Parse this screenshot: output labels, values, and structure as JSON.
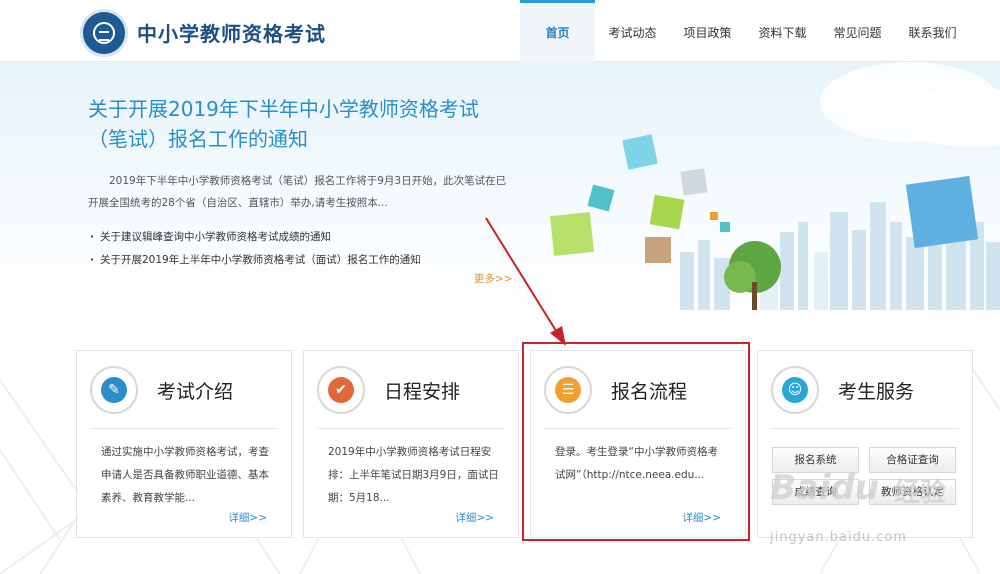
{
  "header": {
    "site_title": "中小学教师资格考试",
    "nav": [
      {
        "label": "首页",
        "active": true
      },
      {
        "label": "考试动态"
      },
      {
        "label": "项目政策"
      },
      {
        "label": "资料下载"
      },
      {
        "label": "常见问题"
      },
      {
        "label": "联系我们"
      }
    ]
  },
  "banner": {
    "headline": "关于开展2019年下半年中小学教师资格考试（笔试）报名工作的通知",
    "summary": "2019年下半年中小学教师资格考试（笔试）报名工作将于9月3日开始，此次笔试在已开展全国统考的28个省（自治区、直辖市）举办,请考生按照本...",
    "links": [
      "关于建议辑峰查询中小学教师资格考试成绩的通知",
      "关于开展2019年上半年中小学教师资格考试（面试）报名工作的通知"
    ],
    "more": "更多>>"
  },
  "cards": [
    {
      "title": "考试介绍",
      "icon": "document-edit-icon",
      "color": "#2a8fc8",
      "desc": "通过实施中小学教师资格考试，考查申请人是否具备教师职业道德、基本素养、教育教学能...",
      "detail": "详细>>"
    },
    {
      "title": "日程安排",
      "icon": "checkmark-icon",
      "color": "#e2683a",
      "desc": "2019年中小学教师资格考试日程安排：上半年笔试日期3月9日，面试日期：5月18...",
      "detail": "详细>>"
    },
    {
      "title": "报名流程",
      "icon": "registration-form-icon",
      "color": "#f0a030",
      "desc": "登录。考生登录“中小学教师资格考试网”（http://ntce.neea.edu...",
      "detail": "详细>>"
    },
    {
      "title": "考生服务",
      "icon": "contact-book-icon",
      "color": "#2aa5d8"
    }
  ],
  "services": [
    "报名系统",
    "合格证查询",
    "成绩查询",
    "教师资格认定"
  ],
  "watermark": {
    "brand": "Baidu",
    "product": "经验",
    "url": "jingyan.baidu.com"
  }
}
